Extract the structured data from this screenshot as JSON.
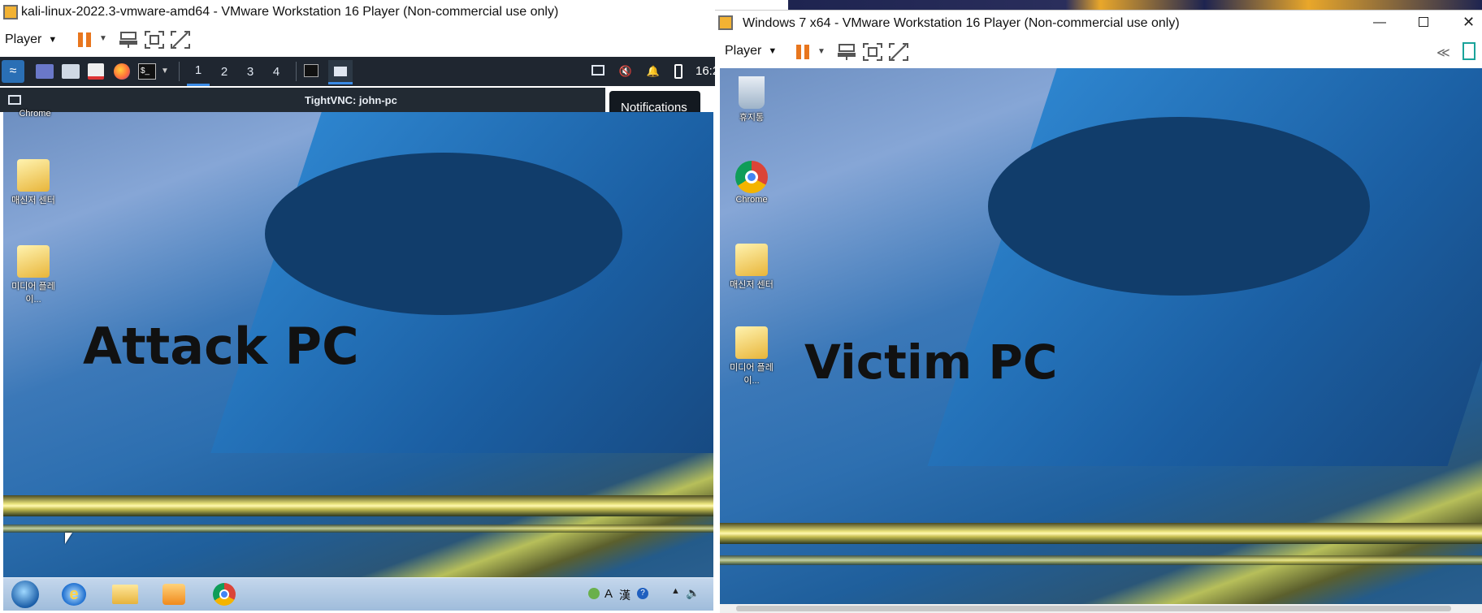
{
  "left_window": {
    "title": "kali-linux-2022.3-vmware-amd64 - VMware Workstation 16 Player (Non-commercial use only)",
    "player_menu": "Player",
    "kali_panel": {
      "workspaces": [
        "1",
        "2",
        "3",
        "4"
      ],
      "clock": "16:2"
    },
    "tooltip": "Notifications",
    "vnc_title": "TightVNC: john-pc",
    "desktop_icons": [
      {
        "label": "Chrome",
        "icon": "chrome-icon"
      },
      {
        "label": "매신저 센터",
        "icon": "messenger-center-icon"
      },
      {
        "label": "미디어 플레이...",
        "icon": "media-player-icon"
      }
    ],
    "overlay_label": "Attack PC",
    "win7_taskbar": {
      "tray_text": [
        "A",
        "漢"
      ]
    }
  },
  "right_window": {
    "title": "Windows 7 x64 - VMware Workstation 16 Player (Non-commercial use only)",
    "player_menu": "Player",
    "desktop_icons": [
      {
        "label": "휴지통",
        "icon": "recycle-bin-icon"
      },
      {
        "label": "Chrome",
        "icon": "chrome-icon"
      },
      {
        "label": "매신저 센터",
        "icon": "messenger-center-icon"
      },
      {
        "label": "미디어 플레이...",
        "icon": "media-player-icon"
      }
    ],
    "overlay_label": "Victim PC"
  },
  "colors": {
    "pause": "#e8761e",
    "kali_panel": "#1f2630",
    "vnc_bar": "#222a33",
    "win7_taskbar": "#a9c3df"
  }
}
